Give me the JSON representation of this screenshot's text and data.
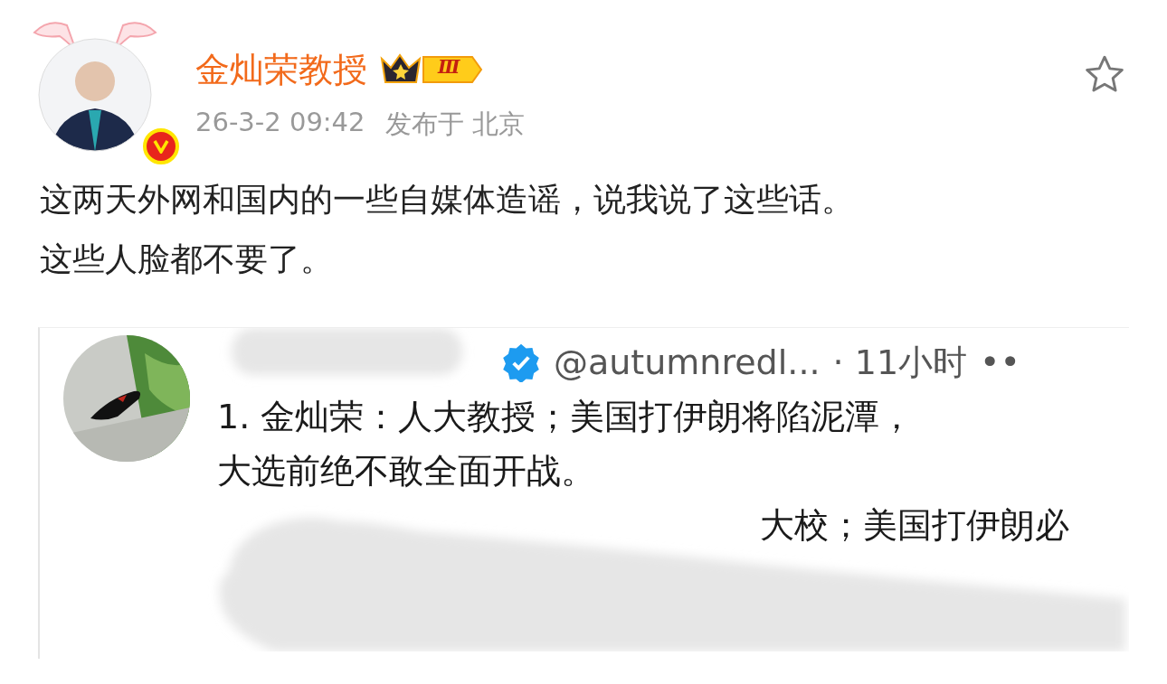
{
  "author": {
    "name": "金灿荣教授",
    "level_badge": "Ⅲ",
    "verified": true,
    "time": "26-3-2 09:42",
    "location": "发布于 北京"
  },
  "favorited": false,
  "text_lines": [
    "这两天外网和国内的一些自媒体造谣，说我说了这些话。",
    "这些人脸都不要了。"
  ],
  "embedded": {
    "handle": "@autumnredl...",
    "age": "· 11小时",
    "more": "••",
    "lines": [
      "1. 金灿荣：人大教授；美国打伊朗将陷泥潭，",
      "大选前绝不敢全面开战。",
      "大校；美国打伊朗必"
    ]
  }
}
